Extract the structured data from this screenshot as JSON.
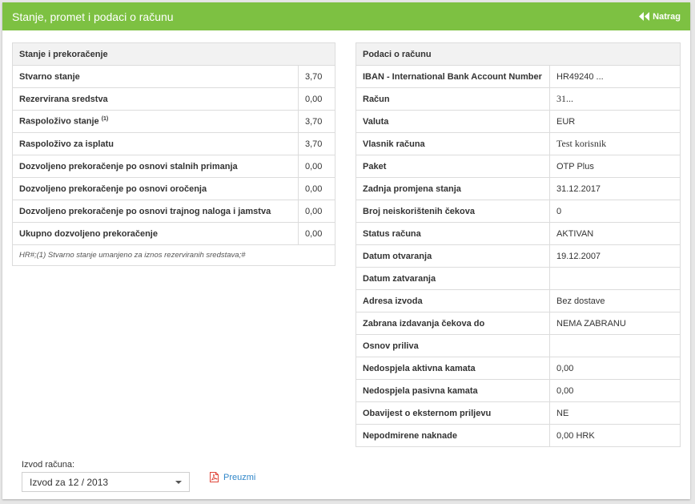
{
  "header": {
    "title": "Stanje, promet i podaci o računu",
    "back_label": "Natrag"
  },
  "balance": {
    "heading": "Stanje i prekoračenje",
    "rows": [
      {
        "label": "Stvarno stanje",
        "value": "3,70"
      },
      {
        "label": "Rezervirana sredstva",
        "value": "0,00"
      },
      {
        "label": "Raspoloživo stanje",
        "sup": "(1)",
        "value": "3,70"
      },
      {
        "label": "Raspoloživo za isplatu",
        "value": "3,70"
      },
      {
        "label": "Dozvoljeno prekoračenje po osnovi stalnih primanja",
        "value": "0,00"
      },
      {
        "label": "Dozvoljeno prekoračenje po osnovi oročenja",
        "value": "0,00"
      },
      {
        "label": "Dozvoljeno prekoračenje po osnovi trajnog naloga i jamstva",
        "value": "0,00"
      },
      {
        "label": "Ukupno dozvoljeno prekoračenje",
        "value": "0,00"
      }
    ],
    "note": "HR#;(1) Stvarno stanje umanjeno za iznos rezerviranih sredstava;#"
  },
  "account": {
    "heading": "Podaci o računu",
    "rows": [
      {
        "label": "IBAN - International Bank Account Number",
        "value": "HR49240 ..."
      },
      {
        "label": "Račun",
        "value": "31...",
        "serif": true
      },
      {
        "label": "Valuta",
        "value": "EUR"
      },
      {
        "label": "Vlasnik računa",
        "value": "Test korisnik",
        "serif": true
      },
      {
        "label": "Paket",
        "value": "OTP Plus"
      },
      {
        "label": "Zadnja promjena stanja",
        "value": "31.12.2017"
      },
      {
        "label": "Broj neiskorištenih čekova",
        "value": "0"
      },
      {
        "label": "Status računa",
        "value": "AKTIVAN"
      },
      {
        "label": "Datum otvaranja",
        "value": "19.12.2007"
      },
      {
        "label": "Datum zatvaranja",
        "value": ""
      },
      {
        "label": "Adresa izvoda",
        "value": "Bez dostave"
      },
      {
        "label": "Zabrana izdavanja čekova do",
        "value": "NEMA ZABRANU"
      },
      {
        "label": "Osnov priliva",
        "value": ""
      },
      {
        "label": "Nedospjela aktivna kamata",
        "value": "0,00"
      },
      {
        "label": "Nedospjela pasivna kamata",
        "value": "0,00"
      },
      {
        "label": "Obavijest o eksternom priljevu",
        "value": "NE"
      },
      {
        "label": "Nepodmirene naknade",
        "value": "0,00 HRK"
      }
    ]
  },
  "statement": {
    "label": "Izvod računa:",
    "selected": "Izvod za 12 / 2013",
    "download_label": "Preuzmi"
  },
  "colors": {
    "accent": "#7dc142",
    "link": "#2f86c9",
    "pdf_icon": "#e0473b"
  }
}
